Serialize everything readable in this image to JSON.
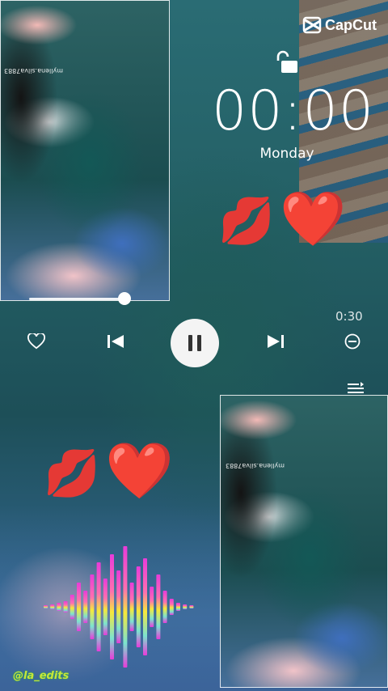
{
  "app": {
    "logo_text": "CapCut"
  },
  "lockscreen": {
    "time": "00:00",
    "day": "Monday"
  },
  "player": {
    "elapsed": "0:30",
    "progress_fraction": 0.6,
    "controls": [
      "heart-icon",
      "previous-icon",
      "pause-icon",
      "next-icon",
      "minus-circle-icon",
      "playlist-icon"
    ]
  },
  "stickers": {
    "kiss": "💋",
    "heart": "❤️"
  },
  "overlays": {
    "panel_caption": "myllena.silva7883",
    "watermark": "@la_edits"
  },
  "colors": {
    "accent_wave_top": "#e83bd9",
    "accent_wave_mid": "#ff7a6a",
    "accent_wave_bottom": "#f6e93a",
    "watermark": "#c7e53a"
  }
}
